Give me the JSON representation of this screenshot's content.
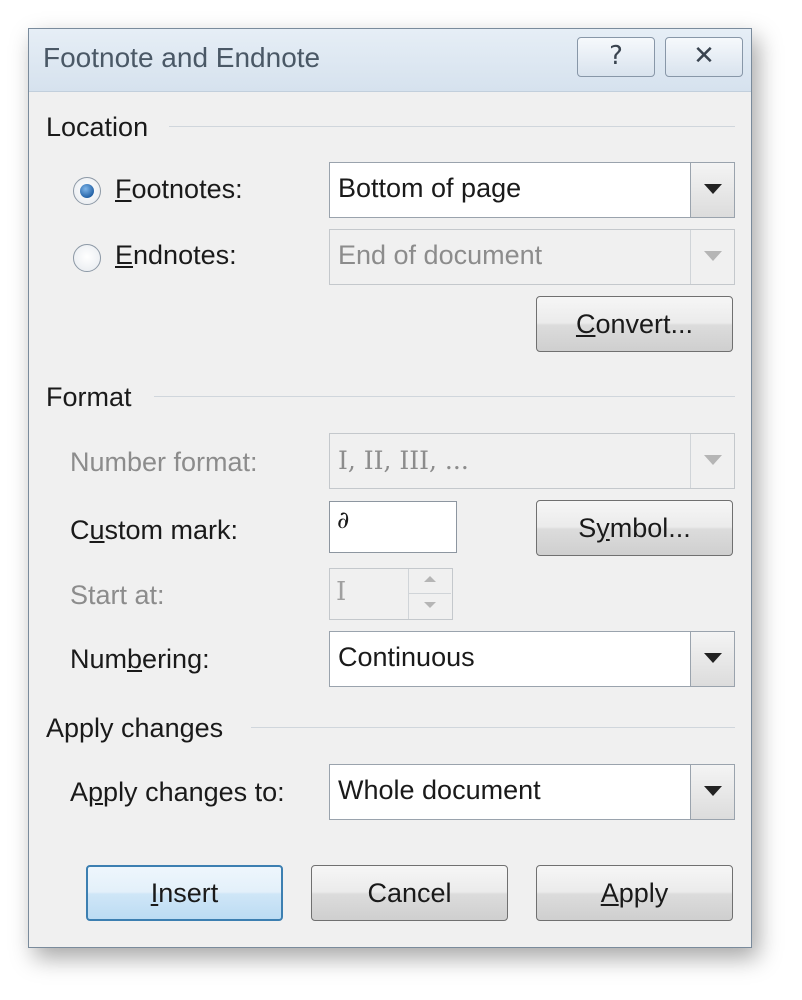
{
  "window": {
    "title": "Footnote and Endnote",
    "help_glyph": "?",
    "close_glyph": "✕"
  },
  "location": {
    "heading": "Location",
    "footnotes": {
      "label_mnemonic": "F",
      "label_rest": "ootnotes:",
      "selected": true,
      "value": "Bottom of page"
    },
    "endnotes": {
      "label_mnemonic": "E",
      "label_rest": "ndnotes:",
      "selected": false,
      "value": "End of document"
    },
    "convert_button": {
      "mnemonic": "C",
      "rest": "onvert..."
    }
  },
  "format": {
    "heading": "Format",
    "number_format": {
      "label": "Number format:",
      "value": "I, II, III, ..."
    },
    "custom_mark": {
      "label_pre": "C",
      "label_mnemonic": "u",
      "label_post": "stom mark:",
      "value": "∂"
    },
    "symbol_button": {
      "pre": "S",
      "mnemonic": "y",
      "post": "mbol..."
    },
    "start_at": {
      "label": "Start at:",
      "value": "I"
    },
    "numbering": {
      "label_pre": "Num",
      "label_mnemonic": "b",
      "label_post": "ering:",
      "value": "Continuous"
    }
  },
  "apply_changes": {
    "heading": "Apply changes",
    "apply_to": {
      "label_pre": "A",
      "label_mnemonic": "p",
      "label_post": "ply changes to:",
      "value": "Whole document"
    }
  },
  "buttons": {
    "insert": {
      "mnemonic": "I",
      "rest": "nsert"
    },
    "cancel": "Cancel",
    "apply": {
      "mnemonic": "A",
      "rest": "pply"
    }
  },
  "colors": {
    "dialog_bg": "#f0f0f0",
    "default_button_border": "#3c7fb1",
    "radio_selected": "#1f5ea3",
    "disabled_text": "#8c8c8c"
  }
}
